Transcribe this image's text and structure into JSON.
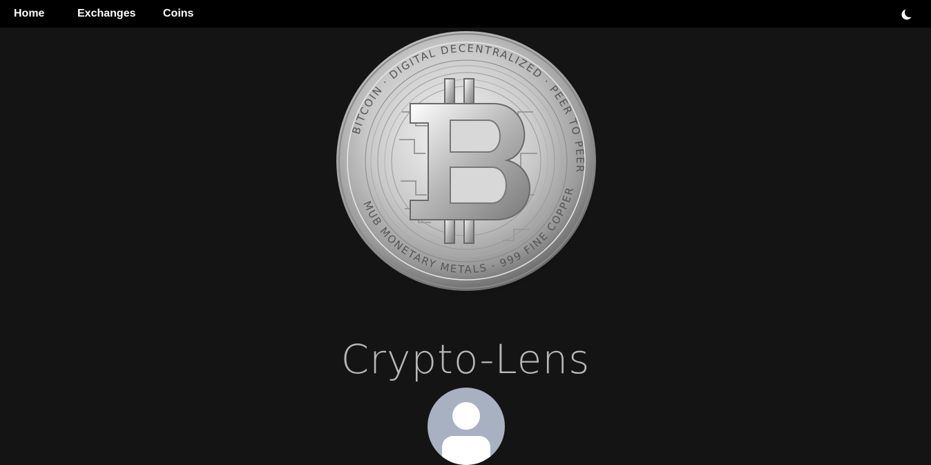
{
  "navbar": {
    "links": [
      {
        "label": "Home"
      },
      {
        "label": "Exchanges"
      },
      {
        "label": "Coins"
      }
    ],
    "theme_toggle_icon": "moon-icon"
  },
  "hero": {
    "image_icon": "bitcoin-coin-image",
    "coin_ring_text": "BITCOIN · DIGITAL DECENTRALIZED · PEER TO PEER",
    "coin_bottom_text": "MUB MONETARY METALS · 999 FINE COPPER"
  },
  "site": {
    "title": "Crypto-Lens"
  },
  "profile": {
    "avatar_icon": "user-avatar-icon"
  },
  "colors": {
    "background": "#141414",
    "navbar": "#000000",
    "nav_text": "#ffffff",
    "title_text": "#b8b8b8",
    "avatar_bg": "#a7b1c2"
  }
}
